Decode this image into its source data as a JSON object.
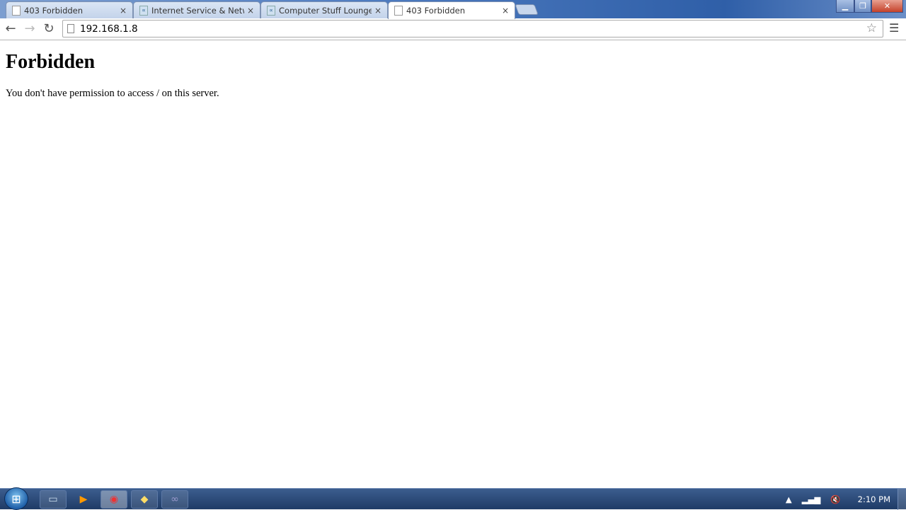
{
  "browser": {
    "tabs": [
      {
        "title": "403 Forbidden",
        "icon": "page-icon",
        "active": false
      },
      {
        "title": "Internet Service & Networ",
        "icon": "site-favicon",
        "active": false
      },
      {
        "title": "Computer Stuff Lounge | I",
        "icon": "site-favicon",
        "active": false
      },
      {
        "title": "403 Forbidden",
        "icon": "page-icon",
        "active": true
      }
    ],
    "close_glyph": "×",
    "address": "192.168.1.8"
  },
  "page": {
    "heading": "Forbidden",
    "message": "You don't have permission to access / on this server."
  },
  "taskbar": {
    "apps": [
      "file-explorer",
      "media-player",
      "chrome",
      "messenger",
      "app"
    ],
    "clock": "2:10 PM"
  }
}
